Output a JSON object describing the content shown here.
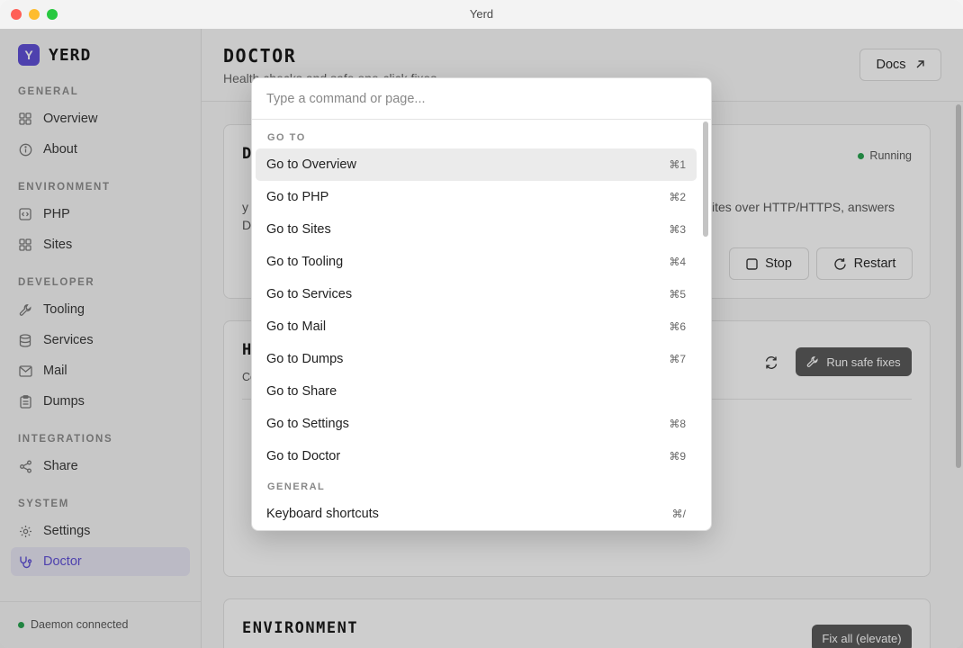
{
  "window": {
    "title": "Yerd"
  },
  "brand": {
    "logo": "Y",
    "name": "YERD"
  },
  "sidebar": {
    "sections": [
      {
        "label": "GENERAL",
        "items": [
          {
            "label": "Overview",
            "icon": "grid-icon"
          },
          {
            "label": "About",
            "icon": "info-icon"
          }
        ]
      },
      {
        "label": "ENVIRONMENT",
        "items": [
          {
            "label": "PHP",
            "icon": "code-icon"
          },
          {
            "label": "Sites",
            "icon": "grid-icon"
          }
        ]
      },
      {
        "label": "DEVELOPER",
        "items": [
          {
            "label": "Tooling",
            "icon": "wrench-icon"
          },
          {
            "label": "Services",
            "icon": "database-icon"
          },
          {
            "label": "Mail",
            "icon": "mail-icon"
          },
          {
            "label": "Dumps",
            "icon": "clipboard-icon"
          }
        ]
      },
      {
        "label": "INTEGRATIONS",
        "items": [
          {
            "label": "Share",
            "icon": "share-icon"
          }
        ]
      },
      {
        "label": "SYSTEM",
        "items": [
          {
            "label": "Settings",
            "icon": "gear-icon"
          },
          {
            "label": "Doctor",
            "icon": "stethoscope-icon",
            "active": true
          }
        ]
      }
    ],
    "footer": {
      "status": "Daemon connected",
      "status_color": "#22a04b"
    }
  },
  "header": {
    "title": "DOCTOR",
    "subtitle": "Health checks and safe one-click fixes",
    "docs_label": "Docs"
  },
  "daemon_card": {
    "title_visible": "D",
    "status": "Running",
    "text_line1_left": "y",
    "text_line1_right": "ites over HTTP/HTTPS, answers",
    "text_line2_left": "D",
    "stop_label": "Stop",
    "restart_label": "Restart"
  },
  "health_card": {
    "title_visible": "H",
    "subtitle_visible": "Co",
    "fix_label": "Run safe fixes"
  },
  "environment_card": {
    "title": "ENVIRONMENT",
    "fix_all_label": "Fix all (elevate)"
  },
  "palette": {
    "placeholder": "Type a command or page...",
    "groups": [
      {
        "label": "GO TO",
        "items": [
          {
            "label": "Go to Overview",
            "shortcut": "⌘1",
            "active": true
          },
          {
            "label": "Go to PHP",
            "shortcut": "⌘2"
          },
          {
            "label": "Go to Sites",
            "shortcut": "⌘3"
          },
          {
            "label": "Go to Tooling",
            "shortcut": "⌘4"
          },
          {
            "label": "Go to Services",
            "shortcut": "⌘5"
          },
          {
            "label": "Go to Mail",
            "shortcut": "⌘6"
          },
          {
            "label": "Go to Dumps",
            "shortcut": "⌘7"
          },
          {
            "label": "Go to Share",
            "shortcut": ""
          },
          {
            "label": "Go to Settings",
            "shortcut": "⌘8"
          },
          {
            "label": "Go to Doctor",
            "shortcut": "⌘9"
          }
        ]
      },
      {
        "label": "GENERAL",
        "items": [
          {
            "label": "Keyboard shortcuts",
            "shortcut": "⌘/"
          }
        ]
      }
    ]
  },
  "colors": {
    "accent": "#5b4bd6",
    "status_ok": "#22a04b"
  }
}
